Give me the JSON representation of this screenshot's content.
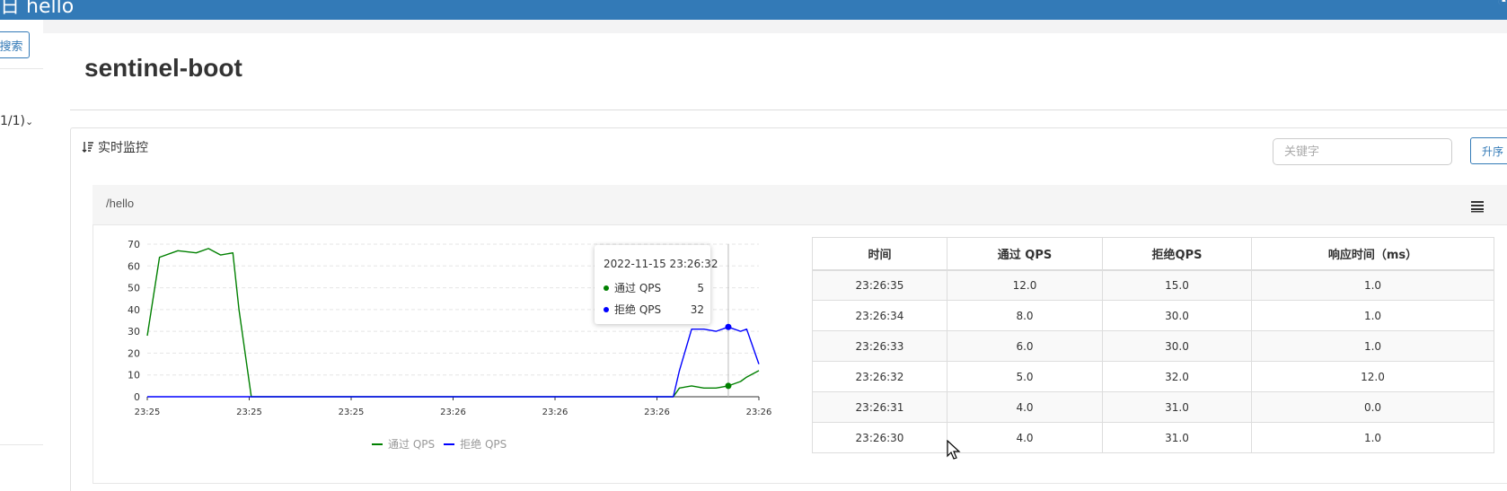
{
  "app": {
    "title": "hello",
    "brand_glyph": "日"
  },
  "sidebar": {
    "search_button_label": "搜索",
    "app_item_label": "1/1)",
    "app_item_chevron": "chevron-down-icon"
  },
  "page": {
    "title": "sentinel-boot"
  },
  "panel": {
    "title": "实时监控",
    "title_icon": "sort-icon",
    "keyword_placeholder": "关键字",
    "sort_button_label": "升序"
  },
  "resource": {
    "name": "/hello",
    "menu_icon": "menu-icon"
  },
  "tooltip": {
    "time": "2022-11-15 23:26:32",
    "rows": [
      {
        "name": "通过 QPS",
        "value": "5",
        "color": "#008000"
      },
      {
        "name": "拒绝 QPS",
        "value": "32",
        "color": "#0000ff"
      }
    ]
  },
  "chart_data": {
    "type": "line",
    "title": "",
    "xlabel": "",
    "ylabel": "",
    "ylim": [
      0,
      70
    ],
    "yticks": [
      0,
      10,
      20,
      30,
      40,
      50,
      60,
      70
    ],
    "xtick_labels": [
      "23:25",
      "23:25",
      "23:25",
      "23:26",
      "23:26",
      "23:26",
      "23:26"
    ],
    "grid": true,
    "legend_position": "bottom",
    "x": [
      0,
      0.02,
      0.05,
      0.08,
      0.1,
      0.12,
      0.14,
      0.15,
      0.17,
      0.18,
      0.5,
      0.86,
      0.87,
      0.89,
      0.91,
      0.93,
      0.95,
      0.97,
      0.98,
      1.0
    ],
    "series": [
      {
        "name": "通过 QPS",
        "color": "#008000",
        "values": [
          28,
          64,
          67,
          66,
          68,
          65,
          66,
          40,
          0,
          0,
          0,
          0,
          4,
          5,
          4,
          4,
          5,
          7,
          9,
          12
        ]
      },
      {
        "name": "拒绝 QPS",
        "color": "#0000ff",
        "values": [
          0,
          0,
          0,
          0,
          0,
          0,
          0,
          0,
          0,
          0,
          0,
          0,
          12,
          31,
          31,
          30,
          32,
          30,
          31,
          15
        ]
      }
    ],
    "highlight_x": 0.95
  },
  "table": {
    "headers": [
      "时间",
      "通过 QPS",
      "拒绝QPS",
      "响应时间（ms）"
    ],
    "rows": [
      [
        "23:26:35",
        "12.0",
        "15.0",
        "1.0"
      ],
      [
        "23:26:34",
        "8.0",
        "30.0",
        "1.0"
      ],
      [
        "23:26:33",
        "6.0",
        "30.0",
        "1.0"
      ],
      [
        "23:26:32",
        "5.0",
        "32.0",
        "12.0"
      ],
      [
        "23:26:31",
        "4.0",
        "31.0",
        "0.0"
      ],
      [
        "23:26:30",
        "4.0",
        "31.0",
        "1.0"
      ]
    ]
  }
}
